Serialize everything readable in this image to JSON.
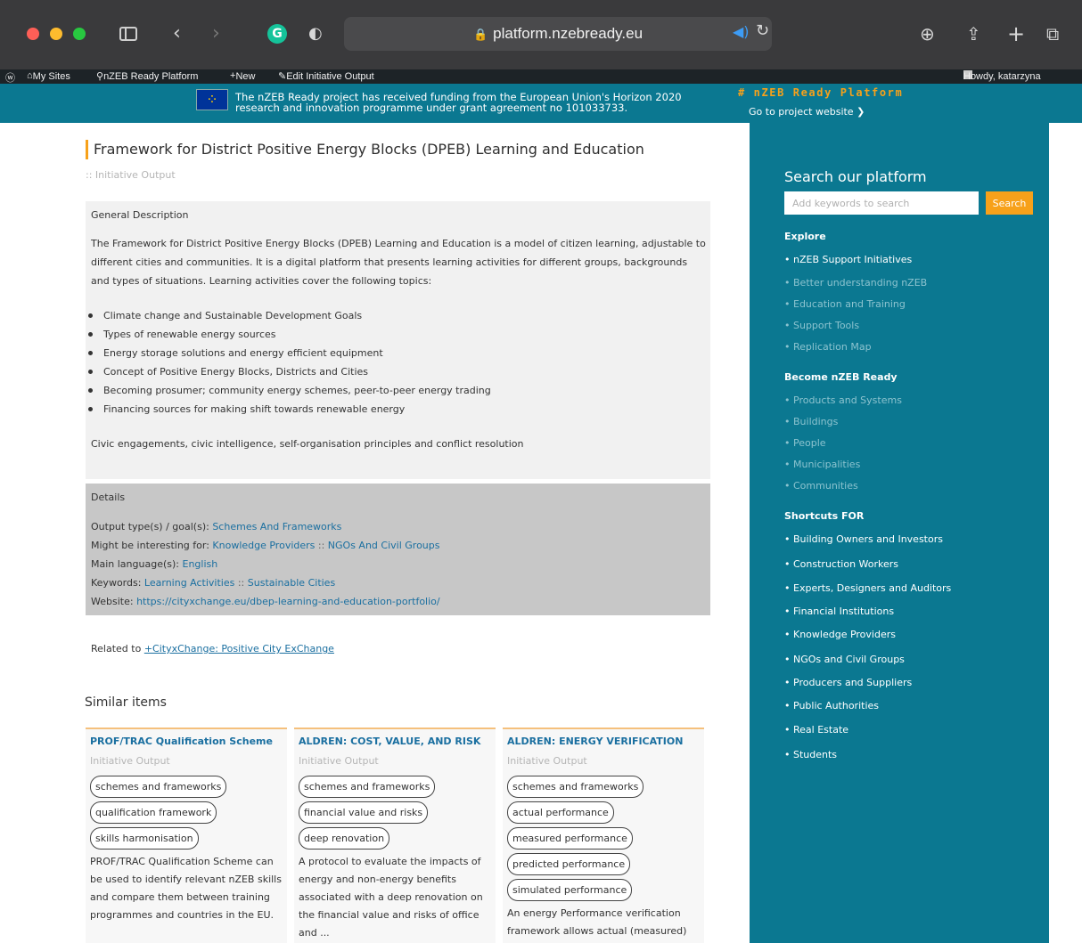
{
  "browser": {
    "url": "platform.nzebready.eu"
  },
  "adminbar": {
    "my_sites": "My Sites",
    "site_name": "nZEB Ready Platform",
    "new_label": "New",
    "edit_label": "Edit Initiative Output",
    "howdy": "Howdy, katarzyna"
  },
  "funding": {
    "text": "The nZEB Ready project has received funding from the European Union's Horizon 2020\nresearch and innovation programme under grant agreement no 101033733.",
    "brand": "# nZEB Ready Platform",
    "goto": "Go to project website ❯"
  },
  "main": {
    "title": "Framework for District Positive Energy Blocks (DPEB) Learning and Education",
    "subtitle": ":: Initiative Output",
    "general_heading": "General Description",
    "description": "The Framework for District Positive Energy Blocks (DPEB) Learning and Education is a model of citizen learning, adjustable to different cities and communities. It is a digital platform that presents learning activities for different groups, backgrounds and types of situations. Learning activities cover the following topics:",
    "topics": [
      "Climate change and Sustainable Development Goals",
      "Types of renewable energy sources",
      "Energy storage solutions and energy efficient equipment",
      "Concept of Positive Energy Blocks, Districts and Cities",
      "Becoming prosumer; community energy schemes, peer-to-peer energy trading",
      "Financing sources for making shift towards renewable energy"
    ],
    "civic": "Civic engagements, civic intelligence, self-organisation principles and conflict resolution",
    "details": {
      "heading": "Details",
      "output_label": "Output type(s) / goal(s): ",
      "output_value": "Schemes And Frameworks",
      "interest_label": "Might be interesting for: ",
      "interest_values": [
        "Knowledge Providers",
        "NGOs And Civil Groups"
      ],
      "separator": " :: ",
      "language_label": "Main language(s): ",
      "language_value": "English",
      "keywords_label": "Keywords: ",
      "keyword_values": [
        "Learning Activities",
        "Sustainable Cities"
      ],
      "website_label": "Website: ",
      "website_value": "https://cityxchange.eu/dbep-learning-and-education-portfolio/"
    },
    "related_label": "Related to ",
    "related_link": "+CityxChange: Positive City ExChange",
    "similar_title": "Similar items",
    "similar": [
      {
        "title": "PROF/TRAC Qualification Scheme",
        "subtitle": "Initiative Output",
        "tags": [
          "schemes and frameworks",
          "qualification framework",
          "skills harmonisation"
        ],
        "description": "PROF/TRAC Qualification Scheme can be used to identify relevant nZEB skills and compare them between training programmes and countries in the EU."
      },
      {
        "title": "ALDREN: COST, VALUE, AND RISK",
        "subtitle": "Initiative Output",
        "tags": [
          "schemes and frameworks",
          "financial value and risks",
          "deep renovation"
        ],
        "description": "A protocol to evaluate the impacts of energy and non-energy benefits associated with a deep renovation on the financial value and risks of office and ..."
      },
      {
        "title": "ALDREN: ENERGY VERIFICATION",
        "subtitle": "Initiative Output",
        "tags": [
          "schemes and frameworks",
          "actual performance",
          "measured performance",
          "predicted performance",
          "simulated performance"
        ],
        "description": "An energy Performance verification framework allows actual (measured)"
      }
    ]
  },
  "sidebar": {
    "search_title": "Search our platform",
    "search_placeholder": "Add keywords to search",
    "search_button": "Search",
    "explore_heading": "Explore",
    "explore": [
      "nZEB Support Initiatives",
      "Better understanding nZEB",
      "Education and Training",
      "Support Tools",
      "Replication Map"
    ],
    "become_heading": "Become nZEB Ready",
    "become": [
      "Products and Systems",
      "Buildings",
      "People",
      "Municipalities",
      "Communities"
    ],
    "shortcuts_heading": "Shortcuts FOR",
    "shortcuts": [
      "Building Owners and Investors",
      "Construction Workers",
      "Experts, Designers and Auditors",
      "Financial Institutions",
      "Knowledge Providers",
      "NGOs and Civil Groups",
      "Producers and Suppliers",
      "Public Authorities",
      "Real Estate",
      "Students"
    ]
  },
  "colors": {
    "teal": "#0b7891",
    "accent_orange": "#f7a11a",
    "link_blue": "#1a6fa0"
  }
}
